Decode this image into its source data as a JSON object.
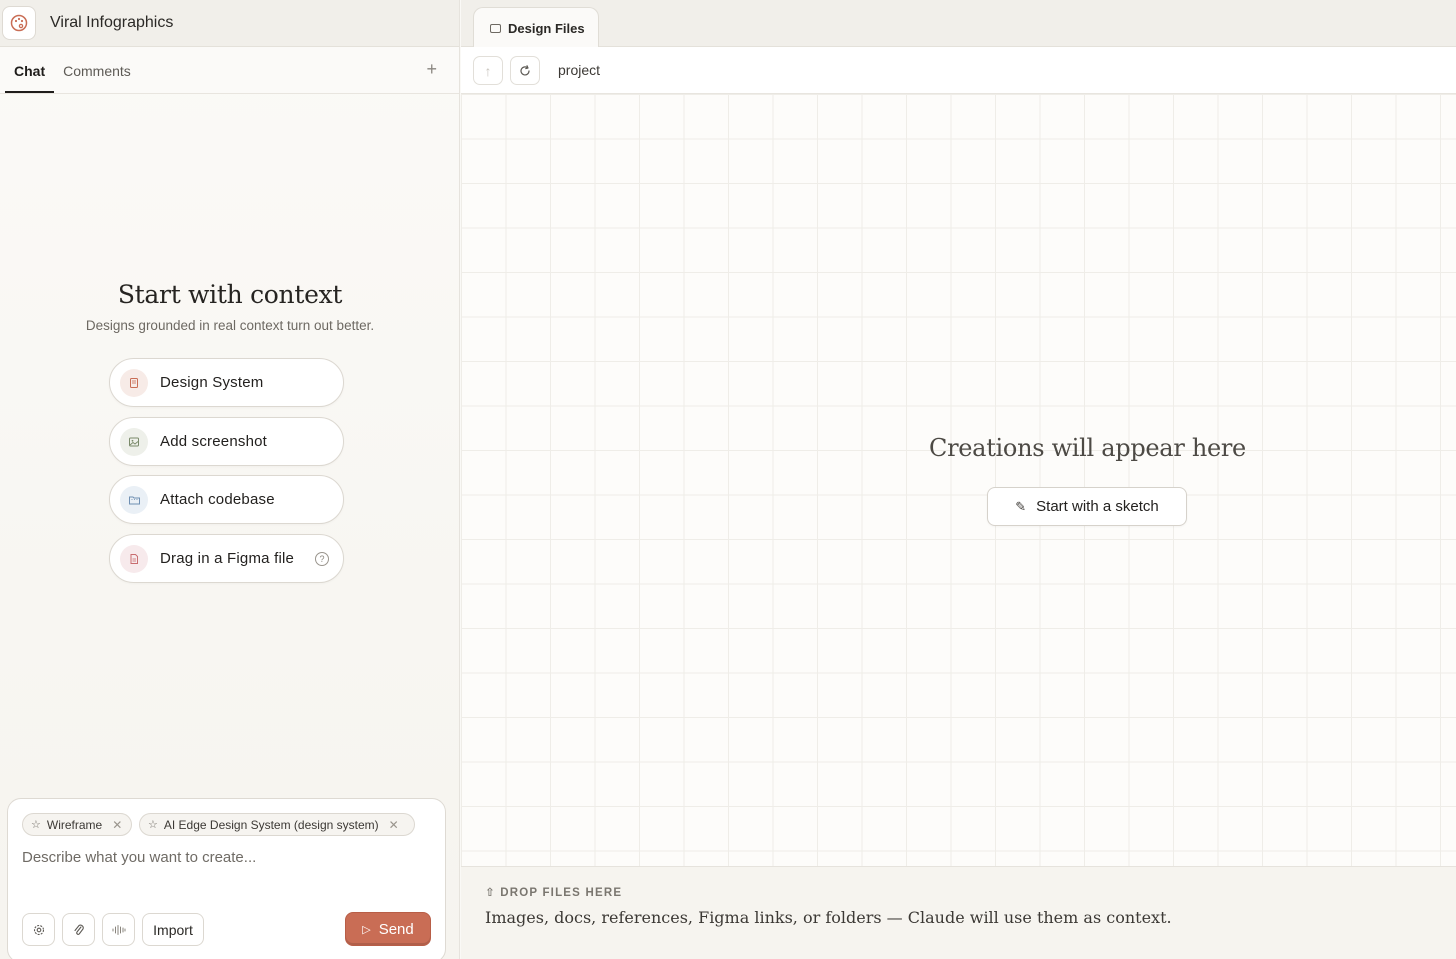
{
  "project": {
    "title": "Viral Infographics",
    "icon": "palette-icon"
  },
  "left_tabs": [
    {
      "label": "Chat",
      "active": true
    },
    {
      "label": "Comments",
      "active": false
    }
  ],
  "add_tab_glyph": "+",
  "context": {
    "title": "Start with context",
    "subtitle": "Designs grounded in real context turn out better.",
    "options": [
      {
        "label": "Design System",
        "icon": "book-icon",
        "color": "#c96d55"
      },
      {
        "label": "Add screenshot",
        "icon": "image-icon",
        "color": "#7a8a6a"
      },
      {
        "label": "Attach codebase",
        "icon": "folder-code-icon",
        "color": "#6f8fb3"
      },
      {
        "label": "Drag in a Figma file",
        "icon": "file-icon",
        "color": "#c96d70"
      }
    ],
    "help_glyph": "?"
  },
  "composer": {
    "chips": [
      {
        "label": "Wireframe"
      },
      {
        "label": "AI Edge Design System (design system)"
      }
    ],
    "placeholder": "Describe what you want to create...",
    "import_label": "Import",
    "send_label": "Send",
    "accent": "#c96d55"
  },
  "right": {
    "tab_label": "Design Files",
    "path": "project",
    "empty_title": "Creations will appear here",
    "sketch_label": "Start with a sketch",
    "drop_label": "DROP FILES HERE",
    "drop_text": "Images, docs, references, Figma links, or folders — Claude will use them as context."
  }
}
